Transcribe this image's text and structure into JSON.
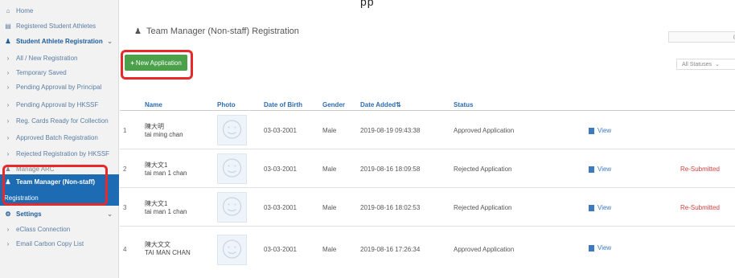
{
  "colors": {
    "accent": "#1c6bb3",
    "button_green": "#4aa14a",
    "highlight_red": "#e8292c",
    "resubmitted_red": "#d43d3d",
    "link_blue": "#3d7ac0"
  },
  "top_fragment": "pp",
  "sidebar": {
    "items": [
      {
        "label": "Home",
        "icon": "home-icon"
      },
      {
        "label": "Registered Student Athletes",
        "icon": "card-icon"
      },
      {
        "label": "Student Athlete Registration",
        "icon": "user-icon"
      },
      {
        "label": "All / New Registration"
      },
      {
        "label": "Temporary Saved"
      },
      {
        "label": "Pending Approval by Principal"
      },
      {
        "label": "Pending Approval by HKSSF"
      },
      {
        "label": "Reg. Cards Ready for Collection"
      },
      {
        "label": "Approved Batch Registration"
      },
      {
        "label": "Rejected Registration by HKSSF"
      },
      {
        "label": "Manage ARC",
        "icon": "users-icon"
      },
      {
        "label": "Team Manager (Non-staff)",
        "icon": "user-icon"
      },
      {
        "label": "Registration"
      },
      {
        "label": "Settings",
        "icon": "gear-icon"
      },
      {
        "label": "eClass Connection"
      },
      {
        "label": "Email Carbon Copy List"
      }
    ]
  },
  "main": {
    "title": "Team Manager (Non-staff) Registration",
    "new_button": "New Application",
    "status_filter": "All Statuses",
    "columns": [
      "Name",
      "Photo",
      "Date of Birth",
      "Gender",
      "Date Added",
      "Status"
    ],
    "rows": [
      {
        "num": "1",
        "name_zh": "陳大明",
        "name_en": "tai ming chan",
        "dob": "03-03-2001",
        "gender": "Male",
        "date_added": "2019-08-19 09:43:38",
        "status": "Approved Application",
        "action": "View",
        "extra": ""
      },
      {
        "num": "2",
        "name_zh": "陳大文1",
        "name_en": "tai man 1 chan",
        "dob": "03-03-2001",
        "gender": "Male",
        "date_added": "2019-08-16 18:09:58",
        "status": "Rejected Application",
        "action": "View",
        "extra": "Re-Submitted"
      },
      {
        "num": "3",
        "name_zh": "陳大文1",
        "name_en": "tai man 1 chan",
        "dob": "03-03-2001",
        "gender": "Male",
        "date_added": "2019-08-16 18:02:53",
        "status": "Rejected Application",
        "action": "View",
        "extra": "Re-Submitted"
      },
      {
        "num": "4",
        "name_zh": "陳大文文",
        "name_en": "TAI MAN CHAN",
        "dob": "03-03-2001",
        "gender": "Male",
        "date_added": "2019-08-16 17:26:34",
        "status": "Approved Application",
        "action": "View",
        "extra": ""
      }
    ]
  }
}
